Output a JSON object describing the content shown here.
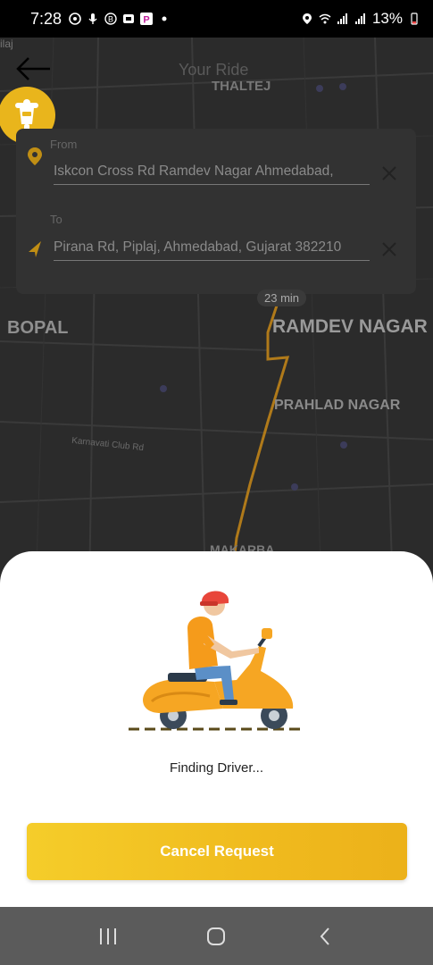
{
  "status_bar": {
    "time": "7:28",
    "battery": "13%",
    "icons_left": [
      "whatsapp-icon",
      "mic-icon",
      "b-icon",
      "tv-icon",
      "p-icon",
      "dot-icon"
    ],
    "icons_right": [
      "location-icon",
      "wifi-icon",
      "signal-icon",
      "signal-icon",
      "battery-icon"
    ]
  },
  "header": {
    "title": "Your Ride"
  },
  "map": {
    "labels": {
      "top_left": "ilaj",
      "thaltej": "THALTEJ",
      "bopal": "BOPAL",
      "ramdev_nagar": "RAMDEV NAGAR",
      "prahlad_nagar": "PRAHLAD NAGAR",
      "makarba": "MAKARBA",
      "road": "Karnavati Club Rd"
    },
    "eta": "23 min"
  },
  "route": {
    "from_label": "From",
    "from_value": "Iskcon Cross Rd Ramdev Nagar Ahmedabad,",
    "to_label": "To",
    "to_value": "Pirana Rd, Piplaj, Ahmedabad, Gujarat 382210"
  },
  "sheet": {
    "status_text": "Finding Driver...",
    "cancel_label": "Cancel Request"
  },
  "colors": {
    "accent": "#f0bb1e",
    "map_bg": "#2b2b2b",
    "sheet_bg": "#ffffff",
    "nav_bg": "#5b5b5b"
  }
}
